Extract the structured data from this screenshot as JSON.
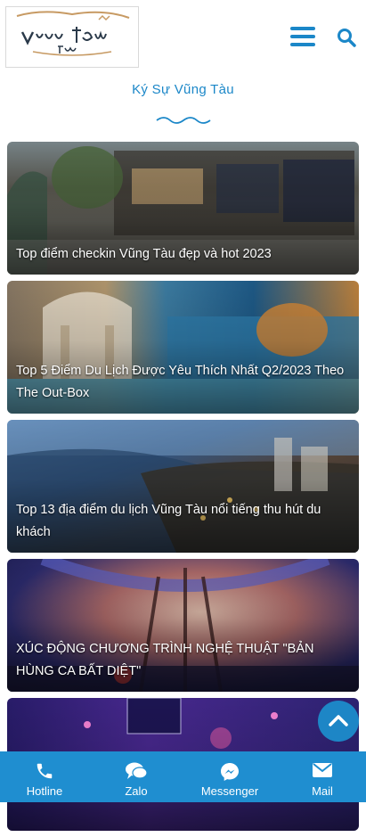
{
  "header": {
    "logo": {
      "alt": "Vũng Tàu Funny logo"
    },
    "menu_icon": "hamburger-icon",
    "search_icon": "search-icon"
  },
  "section": {
    "title": "Ký Sự Vũng Tàu"
  },
  "articles": [
    {
      "title": "Top điểm checkin Vũng Tàu đẹp và hot 2023"
    },
    {
      "title": "Top 5 Điểm Du Lịch Được Yêu Thích Nhất Q2/2023 Theo The Out-Box"
    },
    {
      "title": "Top 13 địa điểm du lịch Vũng Tàu nổi tiếng thu hút du khách"
    },
    {
      "title": "XÚC ĐỘNG CHƯƠNG TRÌNH NGHỆ THUẬT \"BẢN HÙNG CA BẤT DIỆT\""
    },
    {
      "title": ""
    }
  ],
  "bottom_bar": {
    "items": [
      {
        "label": "Hotline",
        "icon": "phone-icon"
      },
      {
        "label": "Zalo",
        "icon": "chat-icon"
      },
      {
        "label": "Messenger",
        "icon": "messenger-icon"
      },
      {
        "label": "Mail",
        "icon": "mail-icon"
      }
    ]
  },
  "colors": {
    "accent": "#1b87c8",
    "bottom_bar": "#1f8ed0"
  }
}
